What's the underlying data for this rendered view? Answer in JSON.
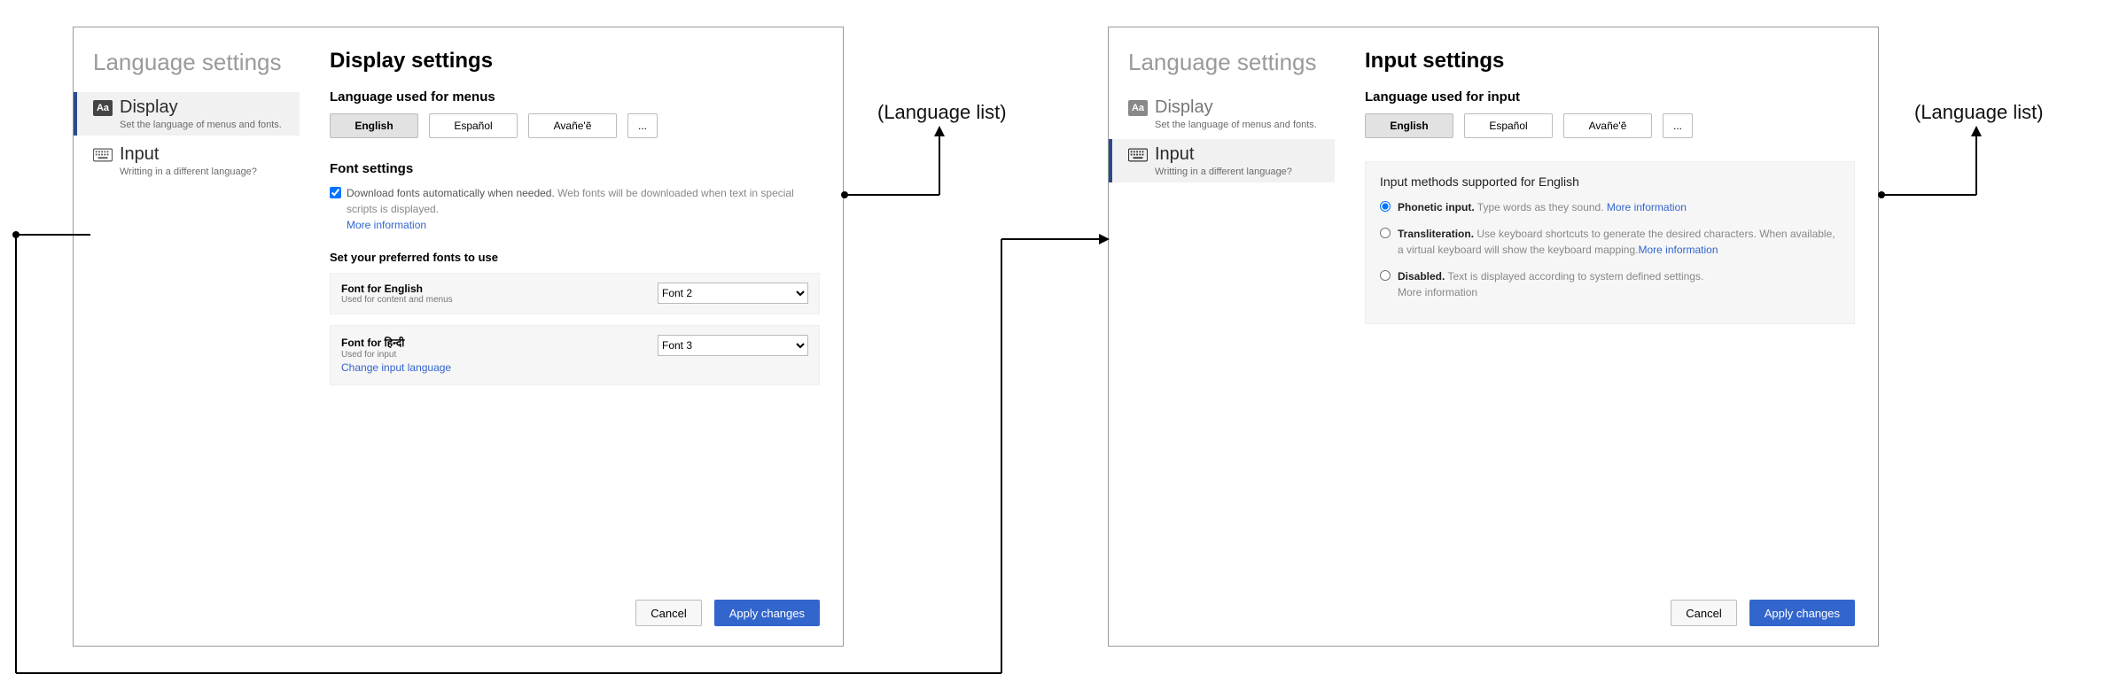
{
  "annotations": {
    "language_list": "(Language list)"
  },
  "sidebar": {
    "title": "Language settings",
    "items": [
      {
        "label": "Display",
        "sub": "Set the language of menus and fonts."
      },
      {
        "label": "Input",
        "sub": "Writting in a different language?"
      }
    ]
  },
  "languages": {
    "btn0": "English",
    "btn1": "Español",
    "btn2": "Avañe'ẽ",
    "more": "..."
  },
  "left": {
    "title": "Display settings",
    "menus_h": "Language used for menus",
    "font_h": "Font settings",
    "dl_label": "Download fonts automatically when needed.",
    "dl_grey": "Web fonts will be downloaded when text in special scripts is displayed.",
    "more_info": "More information",
    "pref_h": "Set your preferred fonts to use",
    "f_en_label": "Font for English",
    "f_en_sub": "Used for content and menus",
    "f_en_sel": "Font 2",
    "f_hi_label": "Font for  हिन्दी",
    "f_hi_sub": "Used for input",
    "f_hi_link": "Change input language",
    "f_hi_sel": "Font 3"
  },
  "right": {
    "title": "Input settings",
    "input_h": "Language used for input",
    "box_h": "Input methods supported for English",
    "opt1_b": "Phonetic input.",
    "opt1_t": "Type words as they sound.",
    "opt2_b": "Transliteration.",
    "opt2_t": "Use keyboard shortcuts to generate the desired characters. When available, a virtual keyboard will show the keyboard mapping.",
    "opt3_b": "Disabled.",
    "opt3_t": "Text is displayed according to system defined settings.",
    "more_info": "More information"
  },
  "footer": {
    "cancel": "Cancel",
    "apply": "Apply changes"
  }
}
